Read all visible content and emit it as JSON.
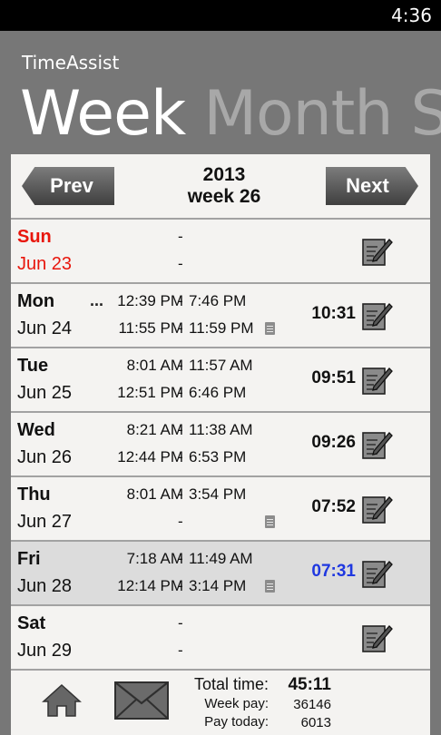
{
  "status_bar": {
    "time": "4:36"
  },
  "app": {
    "title": "TimeAssist"
  },
  "pivot": {
    "items": [
      "Week",
      "Month",
      "S"
    ],
    "active": "Week"
  },
  "nav": {
    "prev_label": "Prev",
    "next_label": "Next",
    "year": "2013",
    "week": "week 26"
  },
  "days": [
    {
      "name": "Sun",
      "date": "Jun 23",
      "weekend_color": "#e8160c",
      "more": "",
      "shifts": [
        {
          "start": "",
          "sep": "-",
          "end": ""
        },
        {
          "start": "",
          "sep": "-",
          "end": ""
        }
      ],
      "note": false,
      "total": ""
    },
    {
      "name": "Mon",
      "date": "Jun 24",
      "more": "...",
      "shifts": [
        {
          "start": "12:39 PM",
          "sep": "-",
          "end": "7:46 PM"
        },
        {
          "start": "11:55 PM",
          "sep": "-",
          "end": "11:59 PM"
        }
      ],
      "note": true,
      "total": "10:31"
    },
    {
      "name": "Tue",
      "date": "Jun 25",
      "more": "",
      "shifts": [
        {
          "start": "8:01 AM",
          "sep": "-",
          "end": "11:57 AM"
        },
        {
          "start": "12:51 PM",
          "sep": "-",
          "end": "6:46 PM"
        }
      ],
      "note": false,
      "total": "09:51"
    },
    {
      "name": "Wed",
      "date": "Jun 26",
      "more": "",
      "shifts": [
        {
          "start": "8:21 AM",
          "sep": "-",
          "end": "11:38 AM"
        },
        {
          "start": "12:44 PM",
          "sep": "-",
          "end": "6:53 PM"
        }
      ],
      "note": false,
      "total": "09:26"
    },
    {
      "name": "Thu",
      "date": "Jun 27",
      "more": "",
      "shifts": [
        {
          "start": "8:01 AM",
          "sep": "-",
          "end": "3:54 PM"
        },
        {
          "start": "",
          "sep": "-",
          "end": ""
        }
      ],
      "note": true,
      "total": "07:52"
    },
    {
      "name": "Fri",
      "date": "Jun 28",
      "more": "",
      "shifts": [
        {
          "start": "7:18 AM",
          "sep": "-",
          "end": "11:49 AM"
        },
        {
          "start": "12:14 PM",
          "sep": "-",
          "end": "3:14 PM"
        }
      ],
      "note": true,
      "total": "07:31",
      "today": true,
      "total_color": "#1f38e0"
    },
    {
      "name": "Sat",
      "date": "Jun 29",
      "more": "",
      "shifts": [
        {
          "start": "",
          "sep": "-",
          "end": ""
        },
        {
          "start": "",
          "sep": "-",
          "end": ""
        }
      ],
      "note": false,
      "total": ""
    }
  ],
  "summary": {
    "total_label": "Total time:",
    "total_value": "45:11",
    "week_pay_label": "Week pay:",
    "week_pay_value": "36146",
    "pay_today_label": "Pay today:",
    "pay_today_value": "6013"
  },
  "icons": {
    "home": "home-icon",
    "mail": "mail-icon",
    "edit": "edit-icon",
    "note": "note-icon"
  },
  "colors": {
    "background": "#777777",
    "panel": "#f4f3f1",
    "weekend": "#e8160c",
    "today_total": "#1f38e0"
  }
}
